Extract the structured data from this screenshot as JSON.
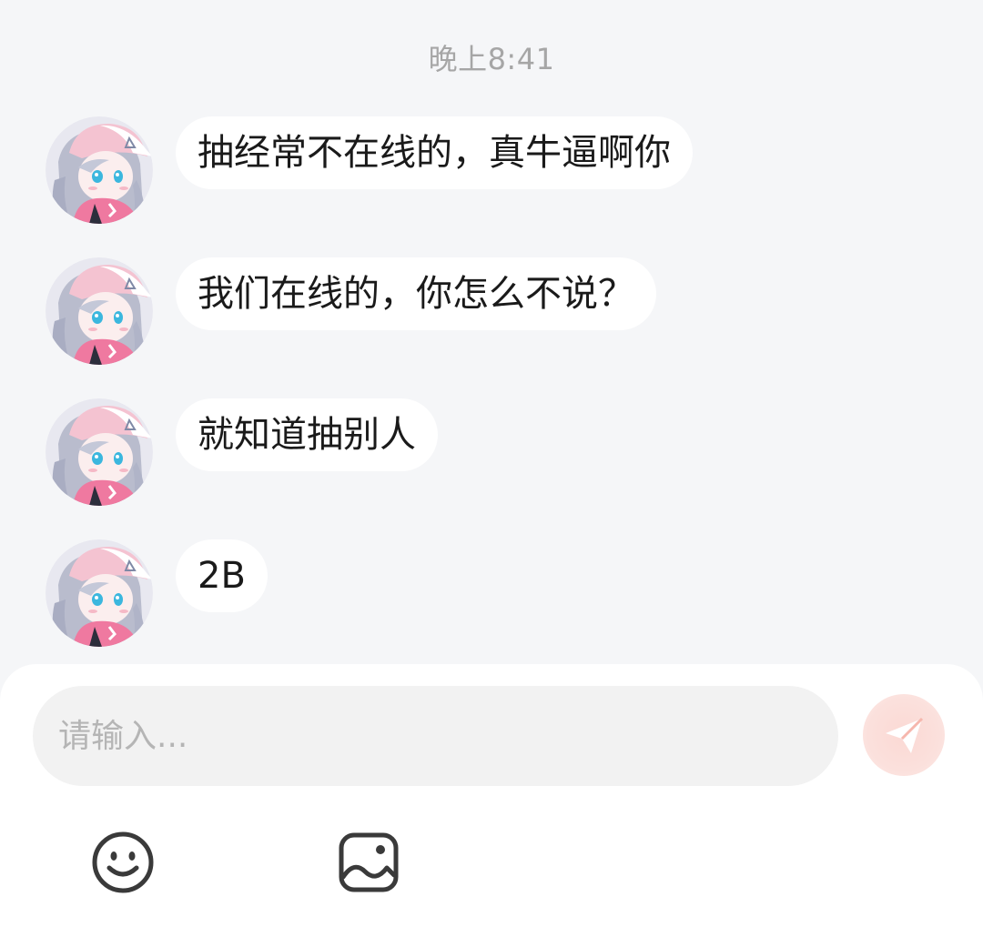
{
  "chat": {
    "timestamp": "晚上8:41",
    "messages": [
      {
        "text": "抽经常不在线的，真牛逼啊你"
      },
      {
        "text": "我们在线的，你怎么不说？"
      },
      {
        "text": "就知道抽别人"
      },
      {
        "text": "2B"
      }
    ]
  },
  "composer": {
    "placeholder": "请输入...",
    "value": ""
  },
  "icons": {
    "send": "send-icon",
    "emoji": "emoji-icon",
    "image": "image-icon"
  },
  "colors": {
    "background": "#f5f6f8",
    "bubble": "#ffffff",
    "send_accent": "#f6b7ad"
  }
}
